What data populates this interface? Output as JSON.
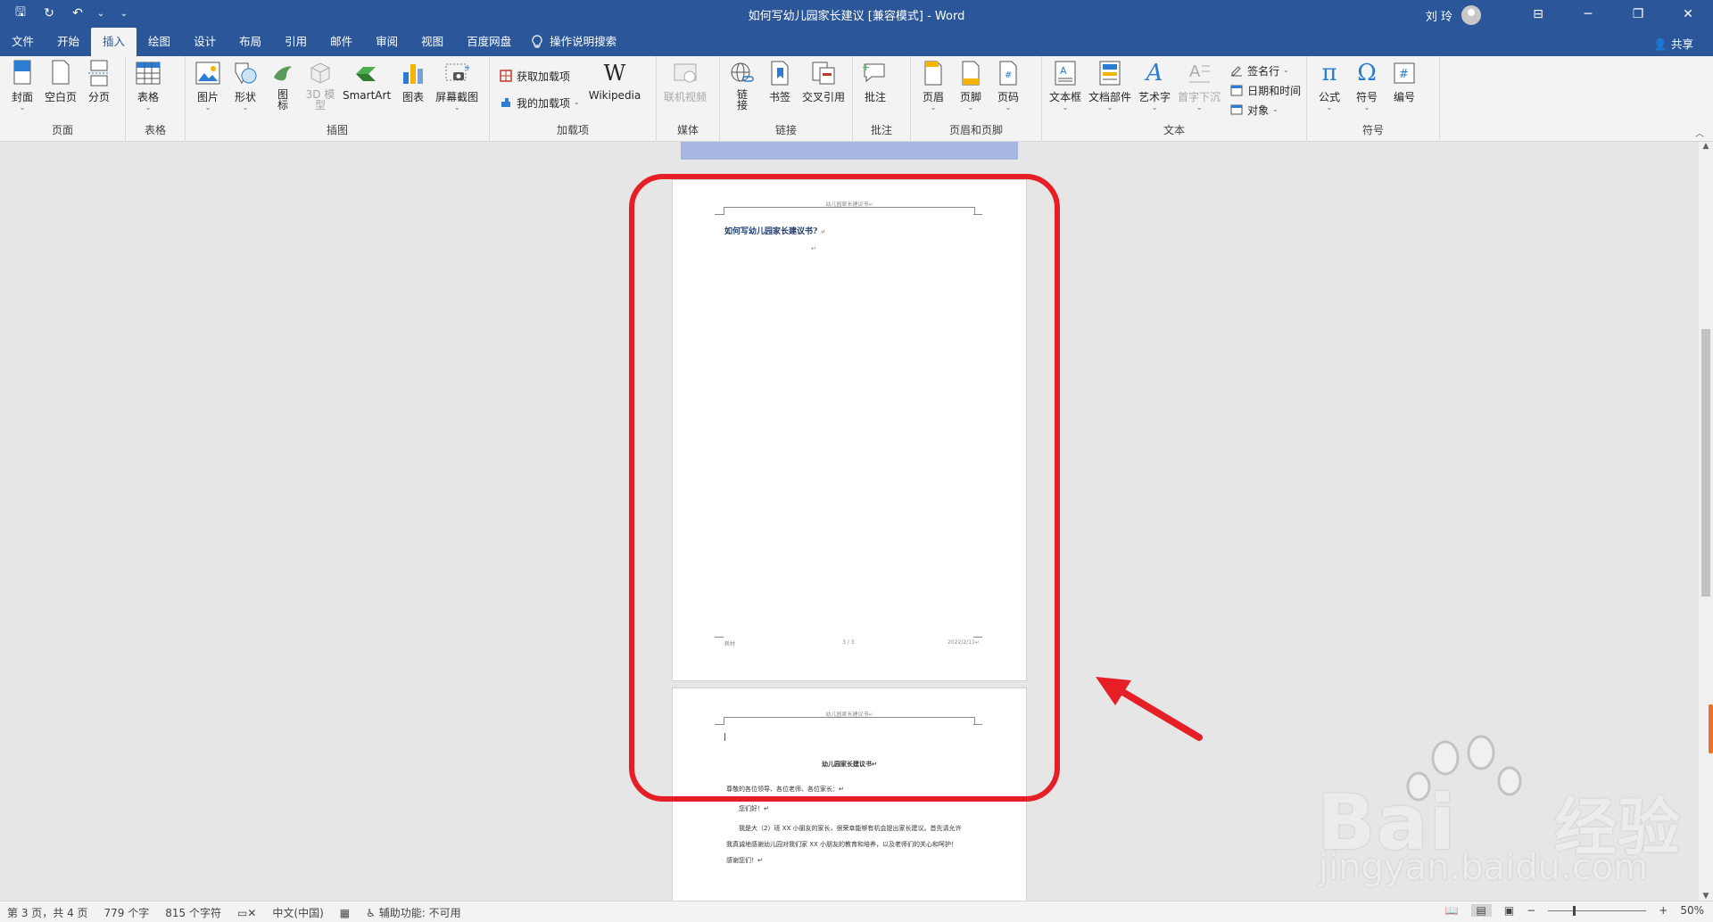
{
  "window": {
    "title": "如何写幼儿园家长建议 [兼容模式]  -  Word",
    "user": "刘 玲",
    "minimize": "─",
    "restore": "❐",
    "close": "✕",
    "ribbon_display": "⊟"
  },
  "qat": {
    "save": "🖫",
    "redo": "↻",
    "undo": "↶",
    "undo_caret": "⌄",
    "customize": "⌄"
  },
  "tabs": [
    {
      "label": "文件"
    },
    {
      "label": "开始"
    },
    {
      "label": "插入",
      "active": true
    },
    {
      "label": "绘图"
    },
    {
      "label": "设计"
    },
    {
      "label": "布局"
    },
    {
      "label": "引用"
    },
    {
      "label": "邮件"
    },
    {
      "label": "审阅"
    },
    {
      "label": "视图"
    },
    {
      "label": "百度网盘"
    }
  ],
  "tell_me": "操作说明搜索",
  "share": "共享",
  "ribbon": {
    "pages": {
      "label": "页面",
      "cover": "封面",
      "blank": "空白页",
      "break": "分页"
    },
    "tables": {
      "label": "表格",
      "table": "表格"
    },
    "illustrations": {
      "label": "插图",
      "picture": "图片",
      "shapes": "形状",
      "icons": "图\n标",
      "model3d": "3D 模\n型",
      "smartart": "SmartArt",
      "chart": "图表",
      "screenshot": "屏幕截图"
    },
    "addins": {
      "label": "加载项",
      "get": "获取加载项",
      "mine": "我的加载项",
      "wiki": "Wikipedia"
    },
    "media": {
      "label": "媒体",
      "video": "联机视频"
    },
    "links": {
      "label": "链接",
      "link": "链\n接",
      "bookmark": "书签",
      "crossref": "交叉引用"
    },
    "comments": {
      "label": "批注",
      "comment": "批注"
    },
    "header_footer": {
      "label": "页眉和页脚",
      "header": "页眉",
      "footer": "页脚",
      "page_number": "页码"
    },
    "text": {
      "label": "文本",
      "textbox": "文本框",
      "quickparts": "文档部件",
      "wordart": "艺术字",
      "dropcap": "首字下沉",
      "signature": "签名行",
      "datetime": "日期和时间",
      "object": "对象"
    },
    "symbols": {
      "label": "符号",
      "equation": "公式",
      "symbol": "符号",
      "number": "编号"
    }
  },
  "document": {
    "header_text": "幼儿园家长建议书↵",
    "title": "如何写幼儿园家长建议书?",
    "return_mark": "↵",
    "footer_left": "耗材",
    "footer_center": "3 / 3",
    "footer_right": "2022/2/11↵",
    "page2_heading": "幼儿园家长建议书↵",
    "page2_lines": [
      "尊敬的各位领导、各位老师、各位家长：↵",
      "您们好！↵",
      "我是大（2）班 XX 小朋友的家长，很荣幸能够有机会提出家长建议。首先请允许",
      "我真诚地感谢幼儿园对我们家 XX 小朋友的教育和培养，以及老师们的关心和呵护！",
      "感谢您们！↵"
    ]
  },
  "watermark": {
    "brand": "Bai",
    "brand2": "经验",
    "url": "jingyan.baidu.com"
  },
  "status": {
    "page": "第 3 页，共 4 页",
    "words": "779 个字",
    "chars": "815 个字符",
    "lang": "中文(中国)",
    "accessibility": "辅助功能: 不可用",
    "zoom": "50%",
    "zoom_minus": "−",
    "zoom_plus": "+"
  },
  "colors": {
    "brand": "#2b579a",
    "annotation": "#e61e25"
  }
}
